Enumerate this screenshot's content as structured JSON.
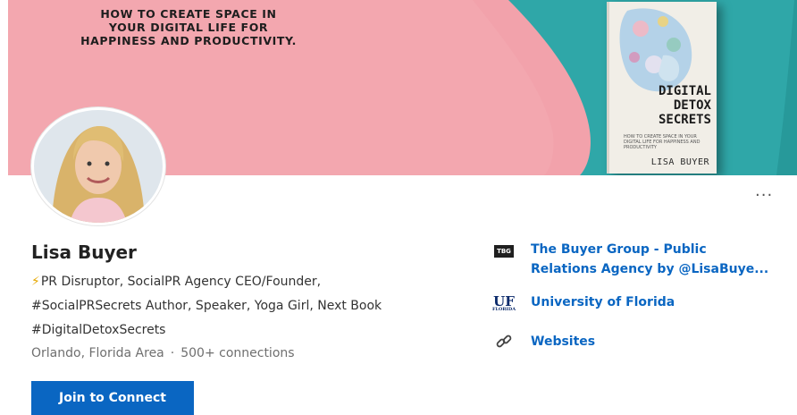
{
  "cover": {
    "banner_lines": [
      "HOW TO CREATE SPACE IN",
      "YOUR DIGITAL LIFE FOR",
      "HAPPINESS AND PRODUCTIVITY."
    ],
    "book_title_lines": [
      "DIGITAL",
      "DETOX",
      "SECRETS"
    ],
    "book_subtitle": "HOW TO CREATE SPACE IN YOUR DIGITAL LIFE FOR HAPPINESS AND PRODUCTIVITY",
    "book_author": "LISA BUYER",
    "colors": {
      "pink": "#f2a2ab",
      "teal": "#2fa7a8"
    }
  },
  "profile": {
    "name": "Lisa Buyer",
    "headline_line1": "PR Disruptor, SocialPR Agency CEO/Founder,",
    "headline_line2": "#SocialPRSecrets Author, Speaker, Yoga Girl, Next Book",
    "headline_line3": "#DigitalDetoxSecrets",
    "headline_icon": "lightning-icon",
    "location": "Orlando, Florida Area",
    "separator": "·",
    "connections": "500+ connections",
    "join_label": "Join to Connect",
    "more_label": "···"
  },
  "sidebar": {
    "company_logo_text": "TBG",
    "company_line1": "The Buyer Group - Public",
    "company_line2": "Relations Agency by @LisaBuye...",
    "school_logo_text": "UF",
    "school_logo_sub": "FLORIDA",
    "school": "University of Florida",
    "websites": "Websites",
    "link_icon": "link-icon"
  },
  "colors": {
    "accent": "#0a66c2",
    "name": "#222222",
    "muted": "#6f6f6f"
  }
}
